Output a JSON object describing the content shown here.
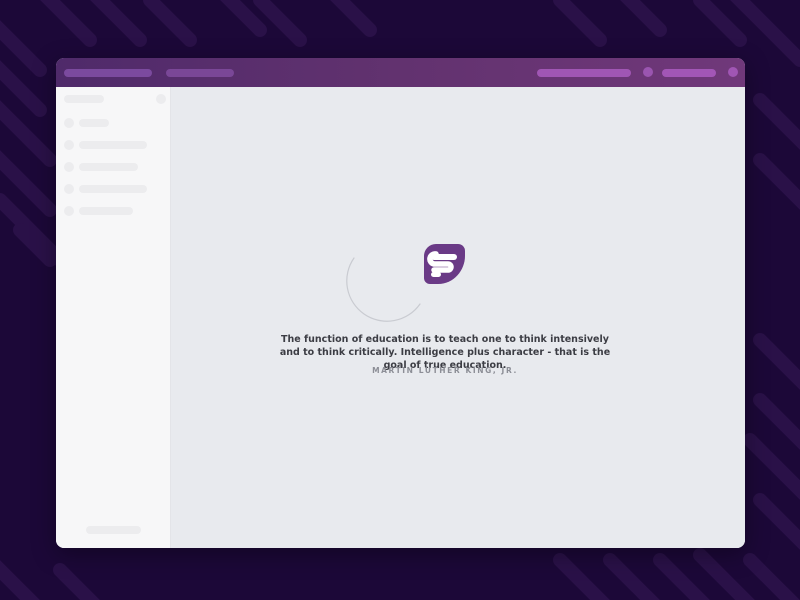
{
  "loading_screen": {
    "quote": "The function of education is to teach one to think intensively and to think critically. Intelligence plus character - that is the goal of true education.",
    "author": "MARTIN LUTHER KING, JR.",
    "logo_icon": "freshgrade-logo-icon",
    "spinner_icon": "loading-spinner-icon"
  },
  "colors": {
    "background": "#1c0838",
    "topbar": "#5e3070",
    "topbar_pill": "#7b4a9e",
    "topbar_pill_bright": "#a056b4",
    "brand": "#6a3a86",
    "content_bg": "#e8eaee",
    "sidebar_bg": "#f7f7f8",
    "text": "#3c3d44",
    "muted_text": "#8c8e96"
  }
}
